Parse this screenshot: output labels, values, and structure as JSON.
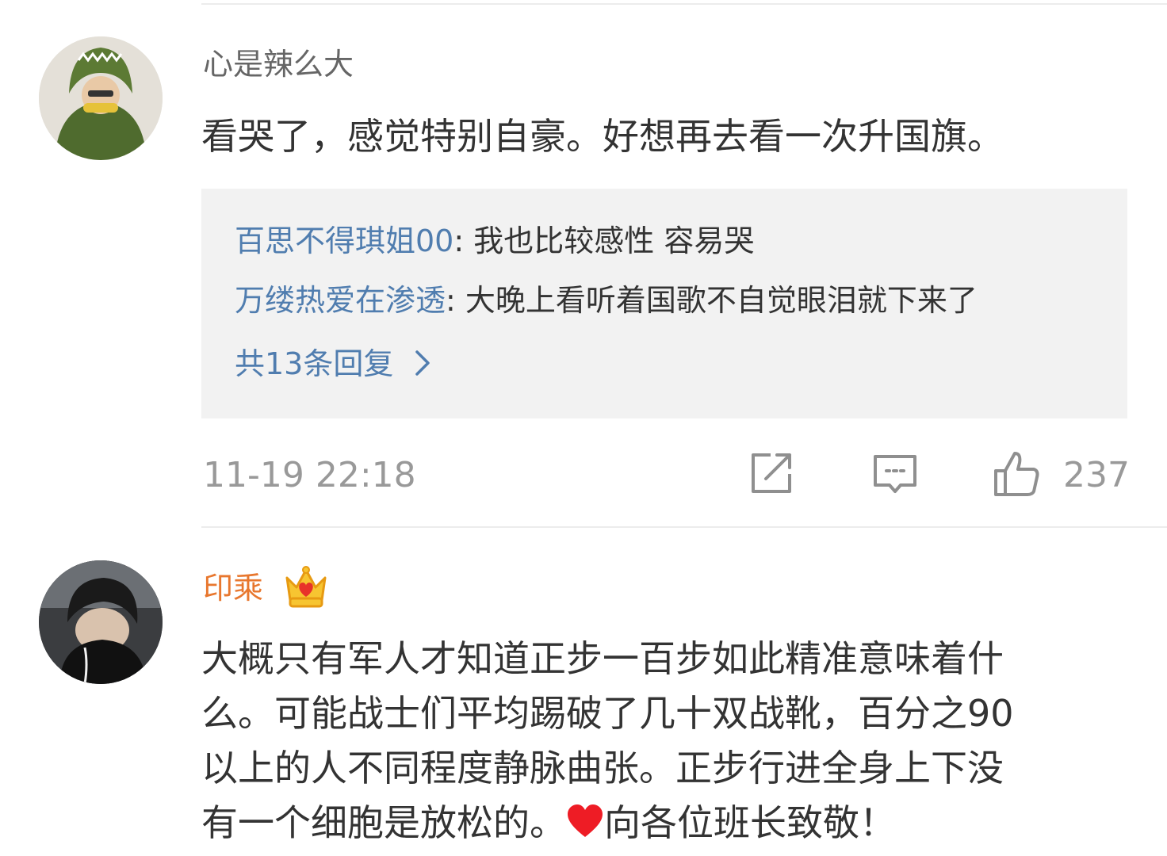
{
  "comments": [
    {
      "username": "心是辣么大",
      "text": "看哭了，感觉特别自豪。好想再去看一次升国旗。",
      "replies": [
        {
          "name": "百思不得琪姐00",
          "sep": ": ",
          "text": "我也比较感性  容易哭"
        },
        {
          "name": "万缕热爱在渗透",
          "sep": ": ",
          "text": "大晚上看听着国歌不自觉眼泪就下来了"
        }
      ],
      "more_replies": "共13条回复",
      "more_replies_icon": "chevron-right-icon",
      "timestamp": "11-19 22:18",
      "actions": {
        "share_icon": "share-icon",
        "comment_icon": "comment-icon",
        "like_icon": "thumbs-up-icon"
      },
      "like_count": "237"
    },
    {
      "username": "印乘",
      "username_color": "#e8772e",
      "badge_icon": "crown-vip-icon",
      "text_lines": [
        "大概只有军人才知道正步一百步如此精准意味着什",
        "么。可能战士们平均踢破了几十双战靴，百分之90",
        "以上的人不同程度静脉曲张。正步行进全身上下没"
      ],
      "last_line_before": "有一个细胞是放松的。",
      "heart_icon": "heart-icon",
      "last_line_after": "向各位班长致敬！"
    }
  ],
  "colors": {
    "link": "#507daf",
    "secondary": "#999999",
    "reply_bg": "#f2f2f2",
    "heart": "#ee1c25"
  }
}
